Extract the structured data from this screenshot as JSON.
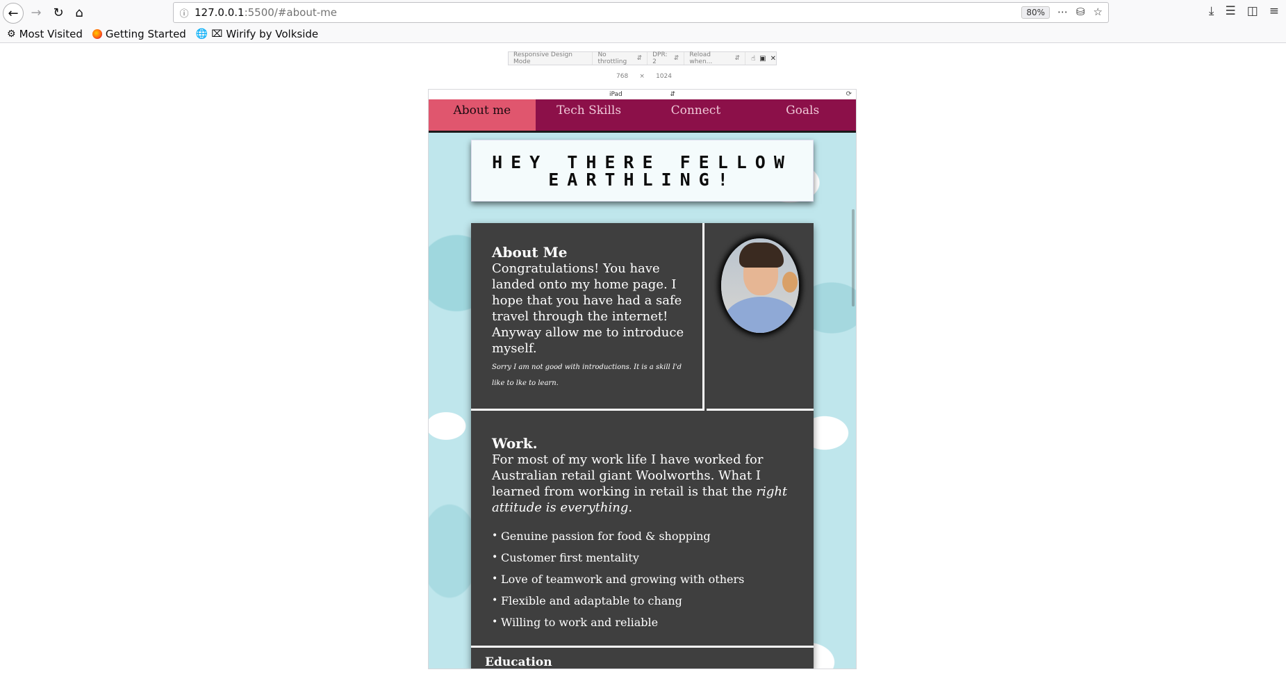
{
  "browser": {
    "url_host": "127.0.0.1",
    "url_path": ":5500/#about-me",
    "zoom": "80%",
    "bookmarks": [
      "Most Visited",
      "Getting Started",
      "Wirify by Volkside"
    ]
  },
  "rdm": {
    "title": "Responsive Design Mode",
    "throttling": "No throttling",
    "dpr": "DPR: 2",
    "reload": "Reload when...",
    "width": "768",
    "times": "×",
    "height": "1024",
    "device": "iPad"
  },
  "site": {
    "nav": [
      "About me",
      "Tech Skills",
      "Connect",
      "Goals"
    ],
    "hero_title": "Hey there fellow earthling!",
    "about_heading": "About Me",
    "about_text": "Congratulations! You have landed onto my home page. I hope that you have had a safe travel through the internet! Anyway allow me to introduce myself.",
    "about_note": "Sorry I am not good with introductions. It is a skill I'd like to lke to learn.",
    "work_heading": "Work.",
    "work_text": "For most of my work life I have worked for Australian retail giant Woolworths. What I learned from working in retail is that the",
    "work_emphasis": "right attitude is everything",
    "work_end": ".",
    "work_items": [
      "Genuine passion for food & shopping",
      "Customer first mentality",
      "Love of teamwork and growing with others",
      "Flexible and adaptable to chang",
      "Willing to work and reliable"
    ],
    "education_heading": "Education"
  }
}
